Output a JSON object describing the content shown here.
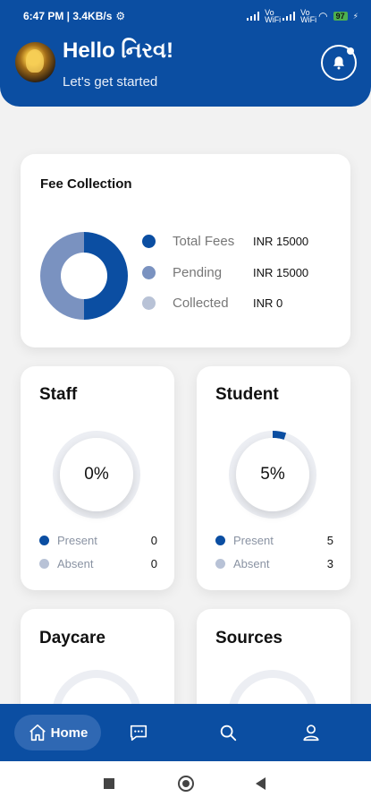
{
  "status_bar": {
    "time": "6:47 PM | 3.4KB/s",
    "network_labels": [
      "Vo WiFi",
      "Vo WiFi"
    ],
    "battery": "97"
  },
  "header": {
    "greeting": "Hello નિરવ!",
    "subtitle": "Let's get started"
  },
  "fee_collection": {
    "title": "Fee Collection",
    "legend": [
      {
        "label": "Total Fees",
        "value": "INR 15000",
        "color": "#0b4ea2"
      },
      {
        "label": "Pending",
        "value": "INR 15000",
        "color": "#7a92c0"
      },
      {
        "label": "Collected",
        "value": "INR 0",
        "color": "#b8c2d6"
      }
    ]
  },
  "staff": {
    "title": "Staff",
    "percent_label": "0%",
    "percent": 0,
    "rows": [
      {
        "label": "Present",
        "value": "0",
        "color": "#0b4ea2"
      },
      {
        "label": "Absent",
        "value": "0",
        "color": "#b8c2d6"
      }
    ]
  },
  "student": {
    "title": "Student",
    "percent_label": "5%",
    "percent": 5,
    "rows": [
      {
        "label": "Present",
        "value": "5",
        "color": "#0b4ea2"
      },
      {
        "label": "Absent",
        "value": "3",
        "color": "#b8c2d6"
      }
    ]
  },
  "daycare": {
    "title": "Daycare"
  },
  "sources": {
    "title": "Sources"
  },
  "bottom_nav": {
    "home_label": "Home",
    "items": [
      "home-icon",
      "chat-icon",
      "search-icon",
      "profile-icon"
    ]
  },
  "colors": {
    "primary": "#0b4ea2",
    "pending": "#7a92c0",
    "muted": "#b8c2d6"
  }
}
